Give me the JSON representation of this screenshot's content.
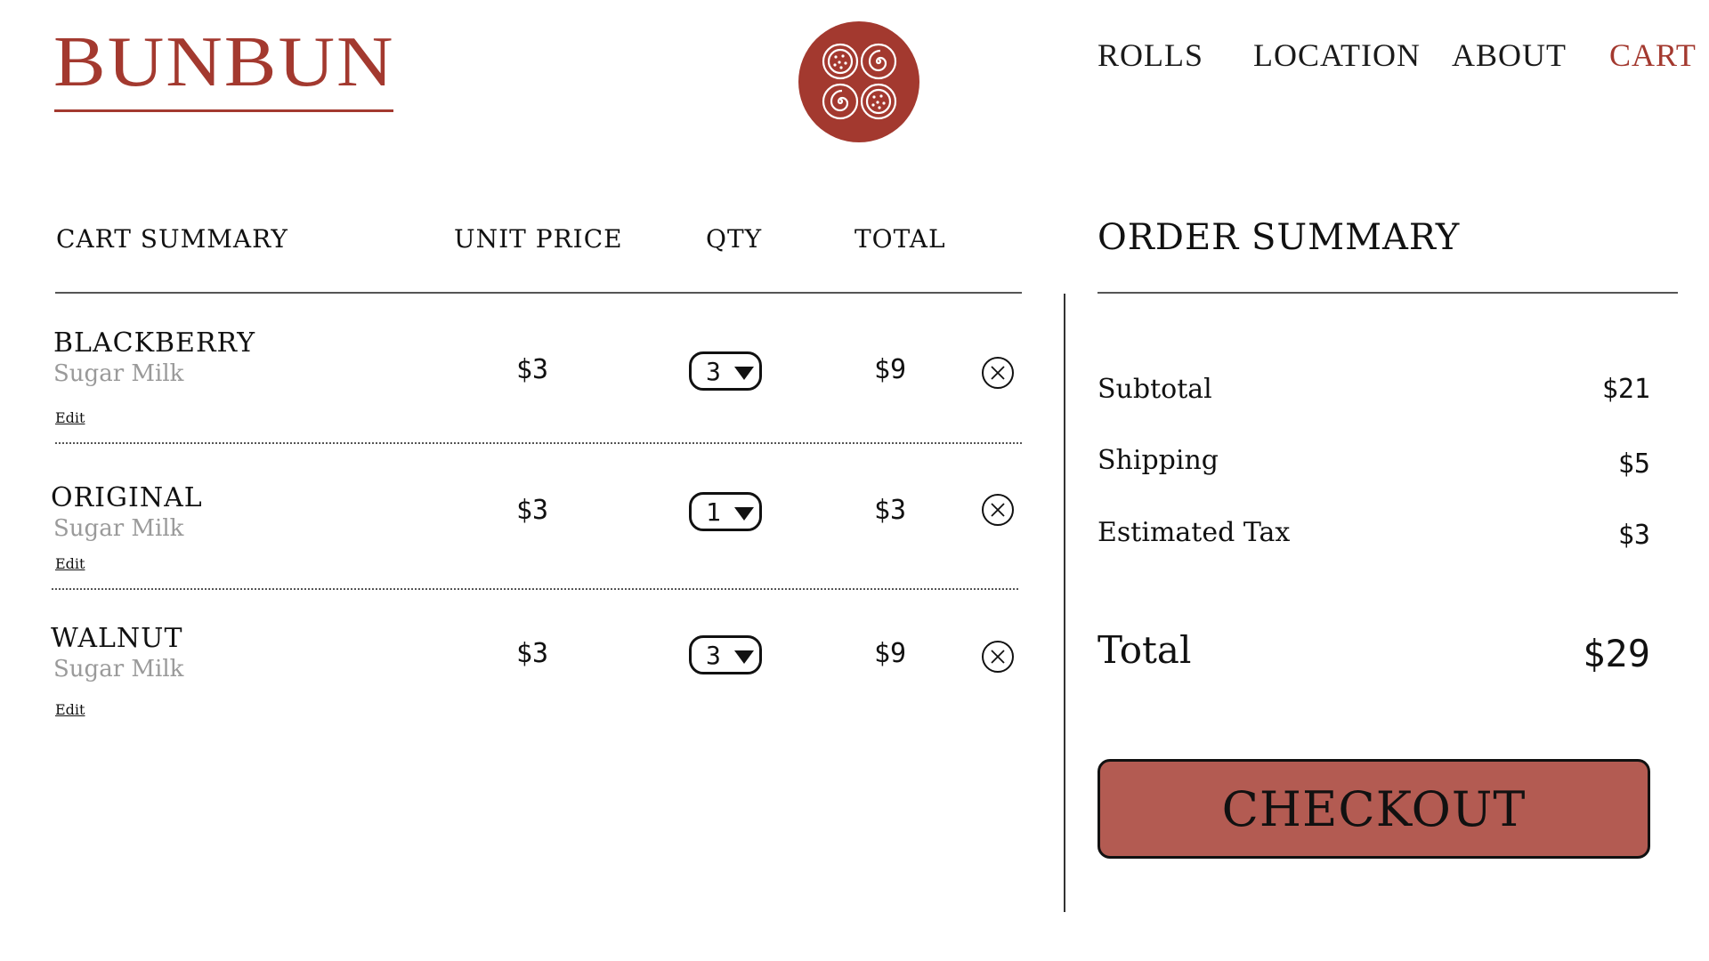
{
  "brand": {
    "name": "BUNBUN",
    "color": "#a3392f",
    "emblem_icon": "cinnamon-roll-emblem-icon"
  },
  "nav": {
    "items": [
      {
        "label": "ROLLS",
        "active": false
      },
      {
        "label": "LOCATION",
        "active": false
      },
      {
        "label": "ABOUT",
        "active": false
      },
      {
        "label": "CART",
        "active": true
      }
    ]
  },
  "cart": {
    "headers": {
      "item": "CART SUMMARY",
      "unit_price": "UNIT PRICE",
      "qty": "QTY",
      "total": "TOTAL"
    },
    "edit_label": "Edit",
    "remove_icon": "close-circle-icon",
    "items": [
      {
        "name": "BLACKBERRY",
        "glaze": "Sugar Milk",
        "unit_price": "$3",
        "qty": "3",
        "total": "$9"
      },
      {
        "name": "ORIGINAL",
        "glaze": "Sugar Milk",
        "unit_price": "$3",
        "qty": "1",
        "total": "$3"
      },
      {
        "name": "WALNUT",
        "glaze": "Sugar Milk",
        "unit_price": "$3",
        "qty": "3",
        "total": "$9"
      }
    ]
  },
  "order": {
    "title": "ORDER SUMMARY",
    "subtotal_label": "Subtotal",
    "subtotal": "$21",
    "shipping_label": "Shipping",
    "shipping": "$5",
    "tax_label": "Estimated Tax",
    "tax": "$3",
    "total_label": "Total",
    "total": "$29",
    "checkout_label": "CHECKOUT",
    "checkout_color": "#b35b52"
  }
}
